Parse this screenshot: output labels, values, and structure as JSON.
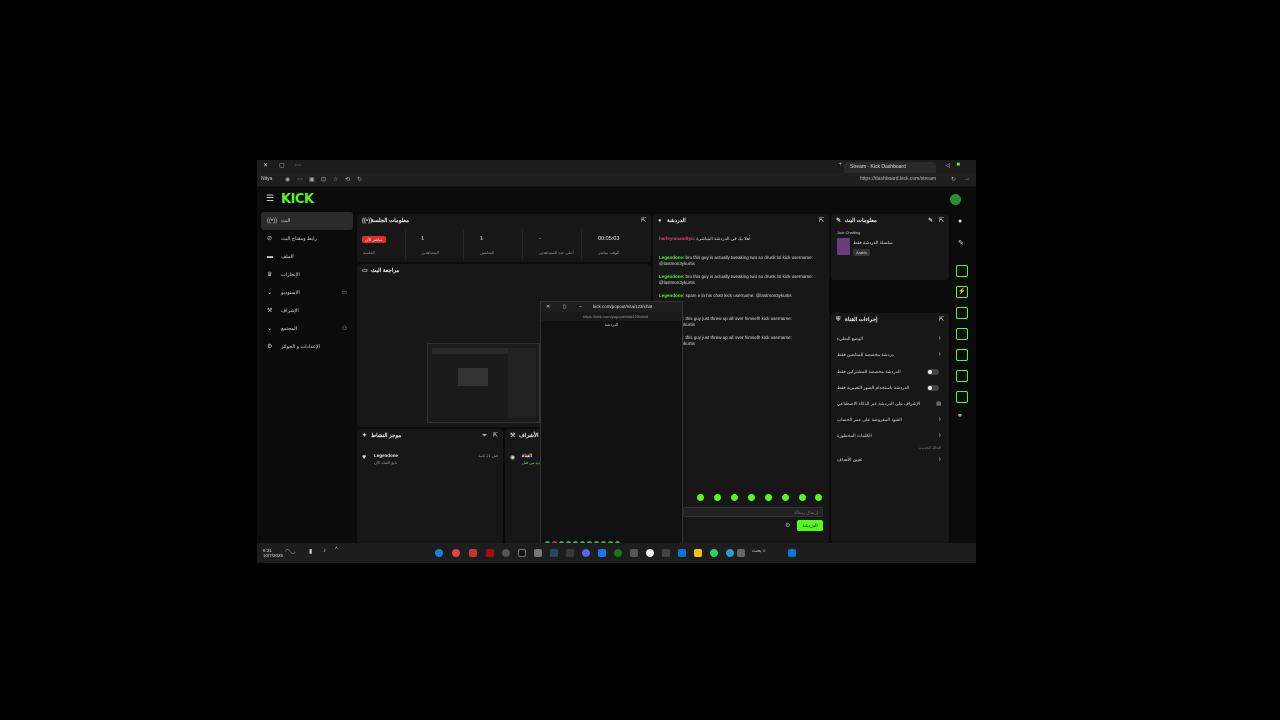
{
  "browser": {
    "tab_title": "Stream - Kick Dashboard",
    "url": "https://dashboard.kick.com/stream",
    "profile_label": "Nitya"
  },
  "app": {
    "logo": "KICK"
  },
  "nav": [
    {
      "label": "البث",
      "icon": "broadcast-icon"
    },
    {
      "label": "رابط ومفتاح البث",
      "icon": "link-icon"
    },
    {
      "label": "الملف",
      "icon": "folder-icon"
    },
    {
      "label": "الإنجازات",
      "icon": "trophy-icon"
    },
    {
      "label": "الاستوديو",
      "icon": "studio-icon"
    },
    {
      "label": "الإشراف",
      "icon": "gavel-icon"
    },
    {
      "label": "المجتمع",
      "icon": "community-icon"
    },
    {
      "label": "الإعدادات و الجوائز",
      "icon": "settings-icon"
    }
  ],
  "session": {
    "title": "معلومات الجلسة",
    "live_badge": "مباشر الآن",
    "stats": [
      {
        "value": "00:05:03",
        "label": "الوقت مباشر"
      },
      {
        "value": "-",
        "label": "أعلى عدد للمشاهدين"
      },
      {
        "value": "1",
        "label": "المتابعين"
      },
      {
        "value": "1",
        "label": "المشاهدين"
      },
      {
        "value": "",
        "label": "الجلسة"
      }
    ]
  },
  "preview": {
    "title": "مراجعة البث"
  },
  "activity": {
    "title": "موجز النشاط",
    "item_user": "Legendone",
    "item_text": "تابع القناة الآن",
    "item_time": "قبل 21 ثانية"
  },
  "extra_panel": {
    "title": "الأشراف",
    "item_user": "القناة",
    "item_text": "متابع جديد من قبل"
  },
  "chat": {
    "title": "الدردشة",
    "messages": [
      {
        "user": "harleymoandtyu",
        "text": "أهلا بك في الدردشة المباشرة"
      },
      {
        "user": "Legendone",
        "text": "bro this guy is actually tweaking two so drunk lol kick username: @lastmon3ykurtis"
      },
      {
        "user": "Legendone",
        "text": "bro this guy is actually tweaking two so drunk lol kick username: @lastmon3ykurtis"
      },
      {
        "user": "Legendone",
        "text": "spam e in his chat! kick username: @lastmon3ykurtis"
      },
      {
        "user": "Legendone",
        "text": "this guy just threw up all over himself! kick username: @lastmon3ykurtis"
      },
      {
        "user": "Legendone",
        "text": "this guy just threw up all over himself! kick username: @lastmon3ykurtis"
      }
    ],
    "input_placeholder": "إرسال رسالة",
    "send_label": "الدردشة"
  },
  "stream_info": {
    "title": "معلومات البث",
    "stream_title": "سلسلة الدردشة فقط",
    "category": "Just Chatting",
    "language_badge": "Arabic"
  },
  "channel_actions": {
    "title": "إجراءات القناة",
    "items": [
      {
        "label": "الوضع البطيء",
        "control": "chevron"
      },
      {
        "label": "دردشة مخصصة للمتابعين فقط",
        "control": "chevron"
      },
      {
        "label": "الدردشة مخصصة للمشتركين فقط",
        "control": "toggle"
      },
      {
        "label": "الدردشة باستخدام الصور التعبيرية فقط",
        "control": "toggle"
      },
      {
        "label": "الإشراف على الدردشة عبر الذكاء الاصطناعي",
        "control": "icon"
      },
      {
        "label": "القيود المفروضة على عمر الحساب",
        "control": "chevron"
      },
      {
        "label": "الكلمات المحظورة",
        "control": "chevron"
      },
      {
        "label": "تعيين الأهداف",
        "control": "chevron"
      }
    ],
    "section_label": "الحالة الجديدة"
  },
  "popup": {
    "title": "kick.com/popout/nitai123/chat",
    "url": "https://kick.com/popout/nitai123/chat",
    "header": "الدردشة",
    "send_label": "الدردشة"
  },
  "taskbar": {
    "time": "6:31",
    "date": "10/7/2025",
    "search_label": "بحث"
  },
  "colors": {
    "accent": "#53fc18",
    "panel": "#171717",
    "background": "#0b0b0b",
    "live": "#e02b2b"
  }
}
